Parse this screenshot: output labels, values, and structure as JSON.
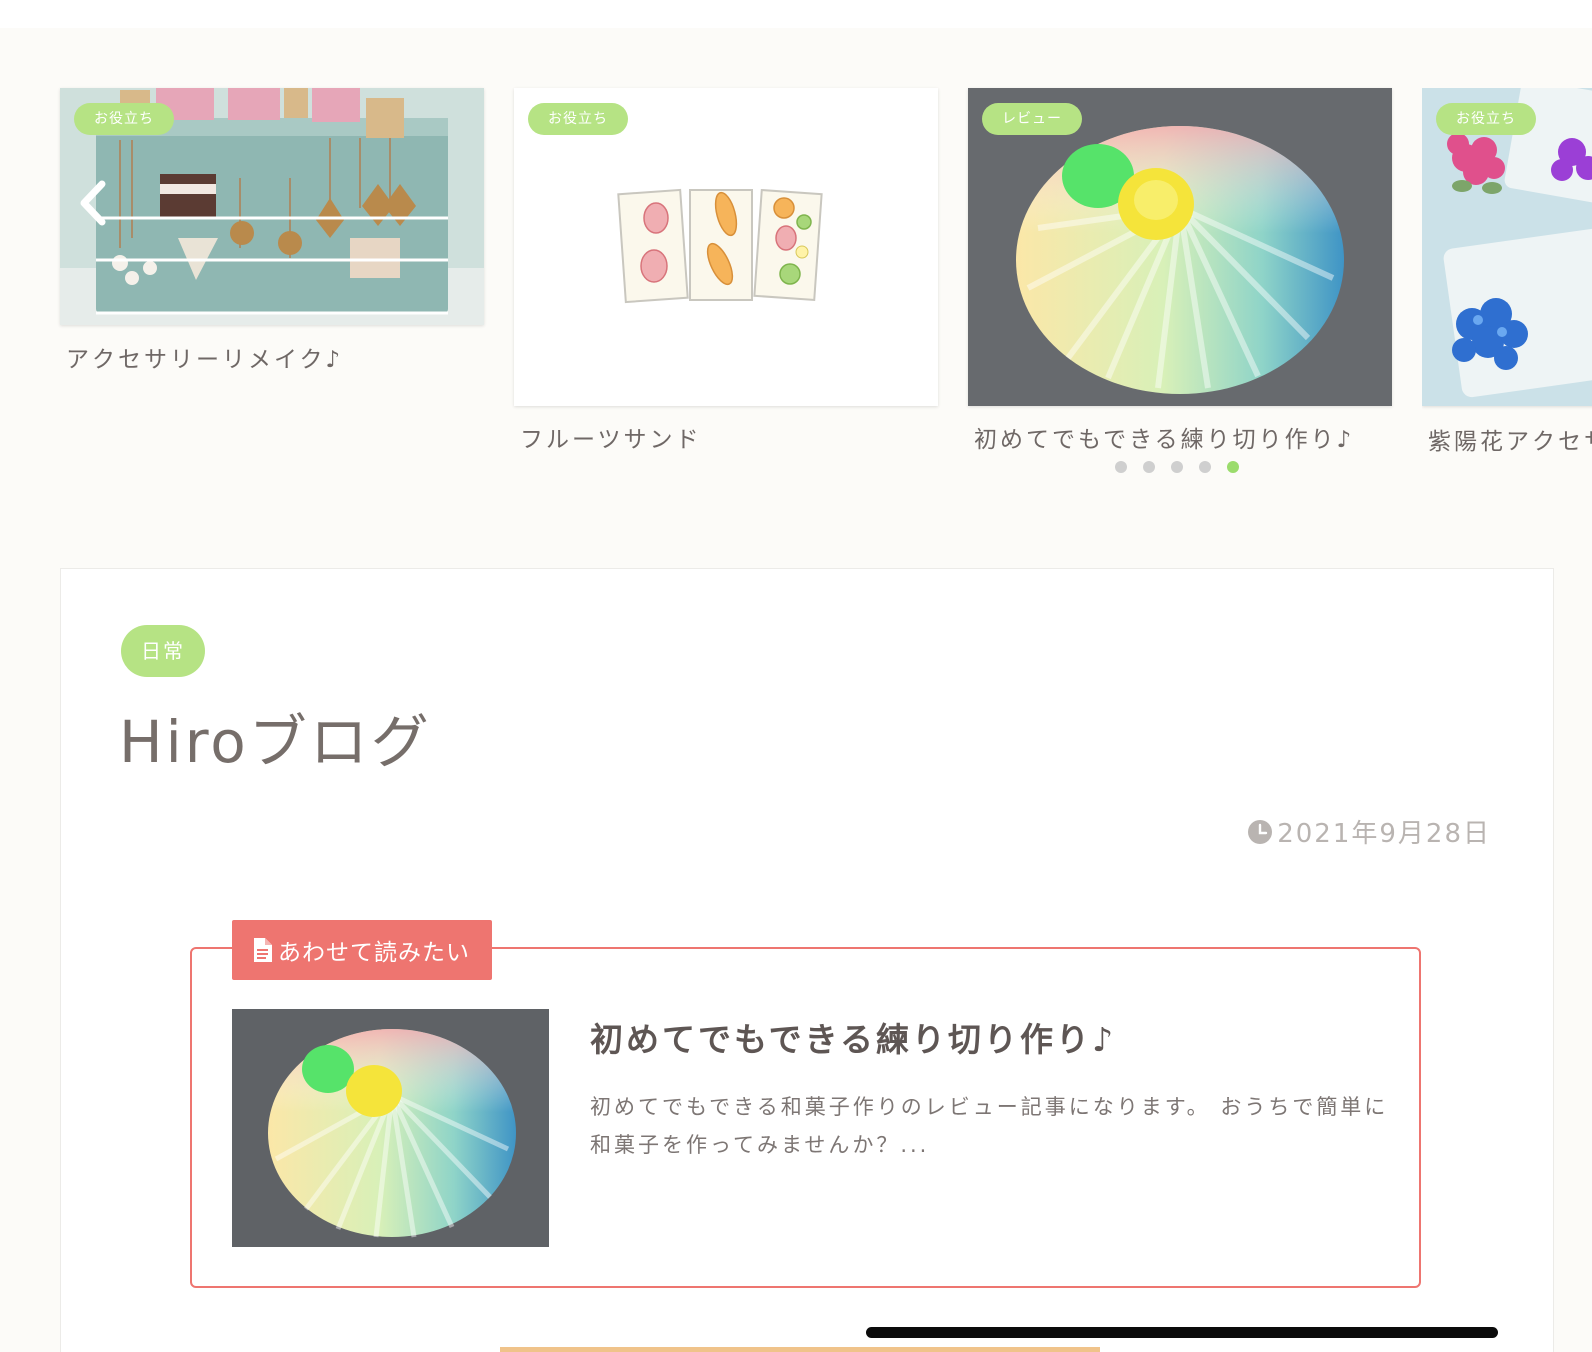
{
  "carousel": {
    "slides": [
      {
        "category": "お役立ち",
        "title": "アクセサリーリメイク♪"
      },
      {
        "category": "お役立ち",
        "title": "フルーツサンド"
      },
      {
        "category": "レビュー",
        "title": "初めてでもできる練り切り作り♪"
      },
      {
        "category": "お役立ち",
        "title": "紫陽花アクセサ"
      }
    ],
    "prev_icon": "chevron-left-icon",
    "dots_total": 5,
    "active_dot": 5
  },
  "post": {
    "category": "日常",
    "title": "Hiroブログ",
    "date": "2021年9月28日",
    "date_icon": "clock-icon"
  },
  "related": {
    "label": "あわせて読みたい",
    "label_icon": "document-icon",
    "title": "初めてでもできる練り切り作り♪",
    "excerpt": "初めてでもできる和菓子作りのレビュー記事になります。 おうちで簡単に和菓子を作ってみませんか？..."
  },
  "colors": {
    "accent_green": "#b6e384",
    "accent_red": "#ee7570",
    "dot_active": "#9bdc6c",
    "background": "#fcfbf8"
  }
}
